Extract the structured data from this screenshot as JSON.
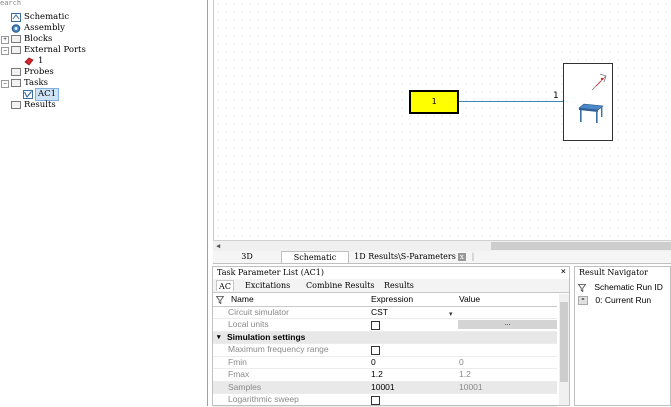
{
  "search": {
    "placeholder": "earch"
  },
  "tree": {
    "schematic": "Schematic",
    "assembly": "Assembly",
    "blocks": "Blocks",
    "external_ports": "External Ports",
    "port_1": "1",
    "probes": "Probes",
    "tasks": "Tasks",
    "ac1": "AC1",
    "results": "Results"
  },
  "canvas": {
    "block_label": "1",
    "pin_label": "1",
    "wire_color": "#3c88b8",
    "block_color": "#ffff00"
  },
  "tabs": {
    "t3d": "3D",
    "schematic": "Schematic",
    "results": "1D Results\\S-Parameters",
    "close_glyph": "x",
    "separator": "|"
  },
  "task_panel": {
    "title": "Task Parameter List (AC1)",
    "close": "×",
    "subtabs": {
      "ac": "AC",
      "excitations": "Excitations",
      "combine": "Combine Results",
      "results": "Results"
    },
    "columns": {
      "name": "Name",
      "expression": "Expression",
      "value": "Value"
    },
    "rows": {
      "simulator": {
        "name": "Circuit simulator",
        "expr": "CST"
      },
      "local_units": {
        "name": "Local units",
        "button": "..."
      },
      "section": "Simulation settings",
      "max_freq": {
        "name": "Maximum frequency range"
      },
      "fmin": {
        "name": "Fmin",
        "expr": "0",
        "value": "0"
      },
      "fmax": {
        "name": "Fmax",
        "expr": "1.2",
        "value": "1.2"
      },
      "samples": {
        "name": "Samples",
        "expr": "10001",
        "value": "10001"
      },
      "log_sweep": {
        "name": "Logarithmic sweep"
      }
    }
  },
  "result_nav": {
    "title": "Result Navigator",
    "run_id": "Schematic Run ID",
    "current_run": "0: Current Run"
  }
}
